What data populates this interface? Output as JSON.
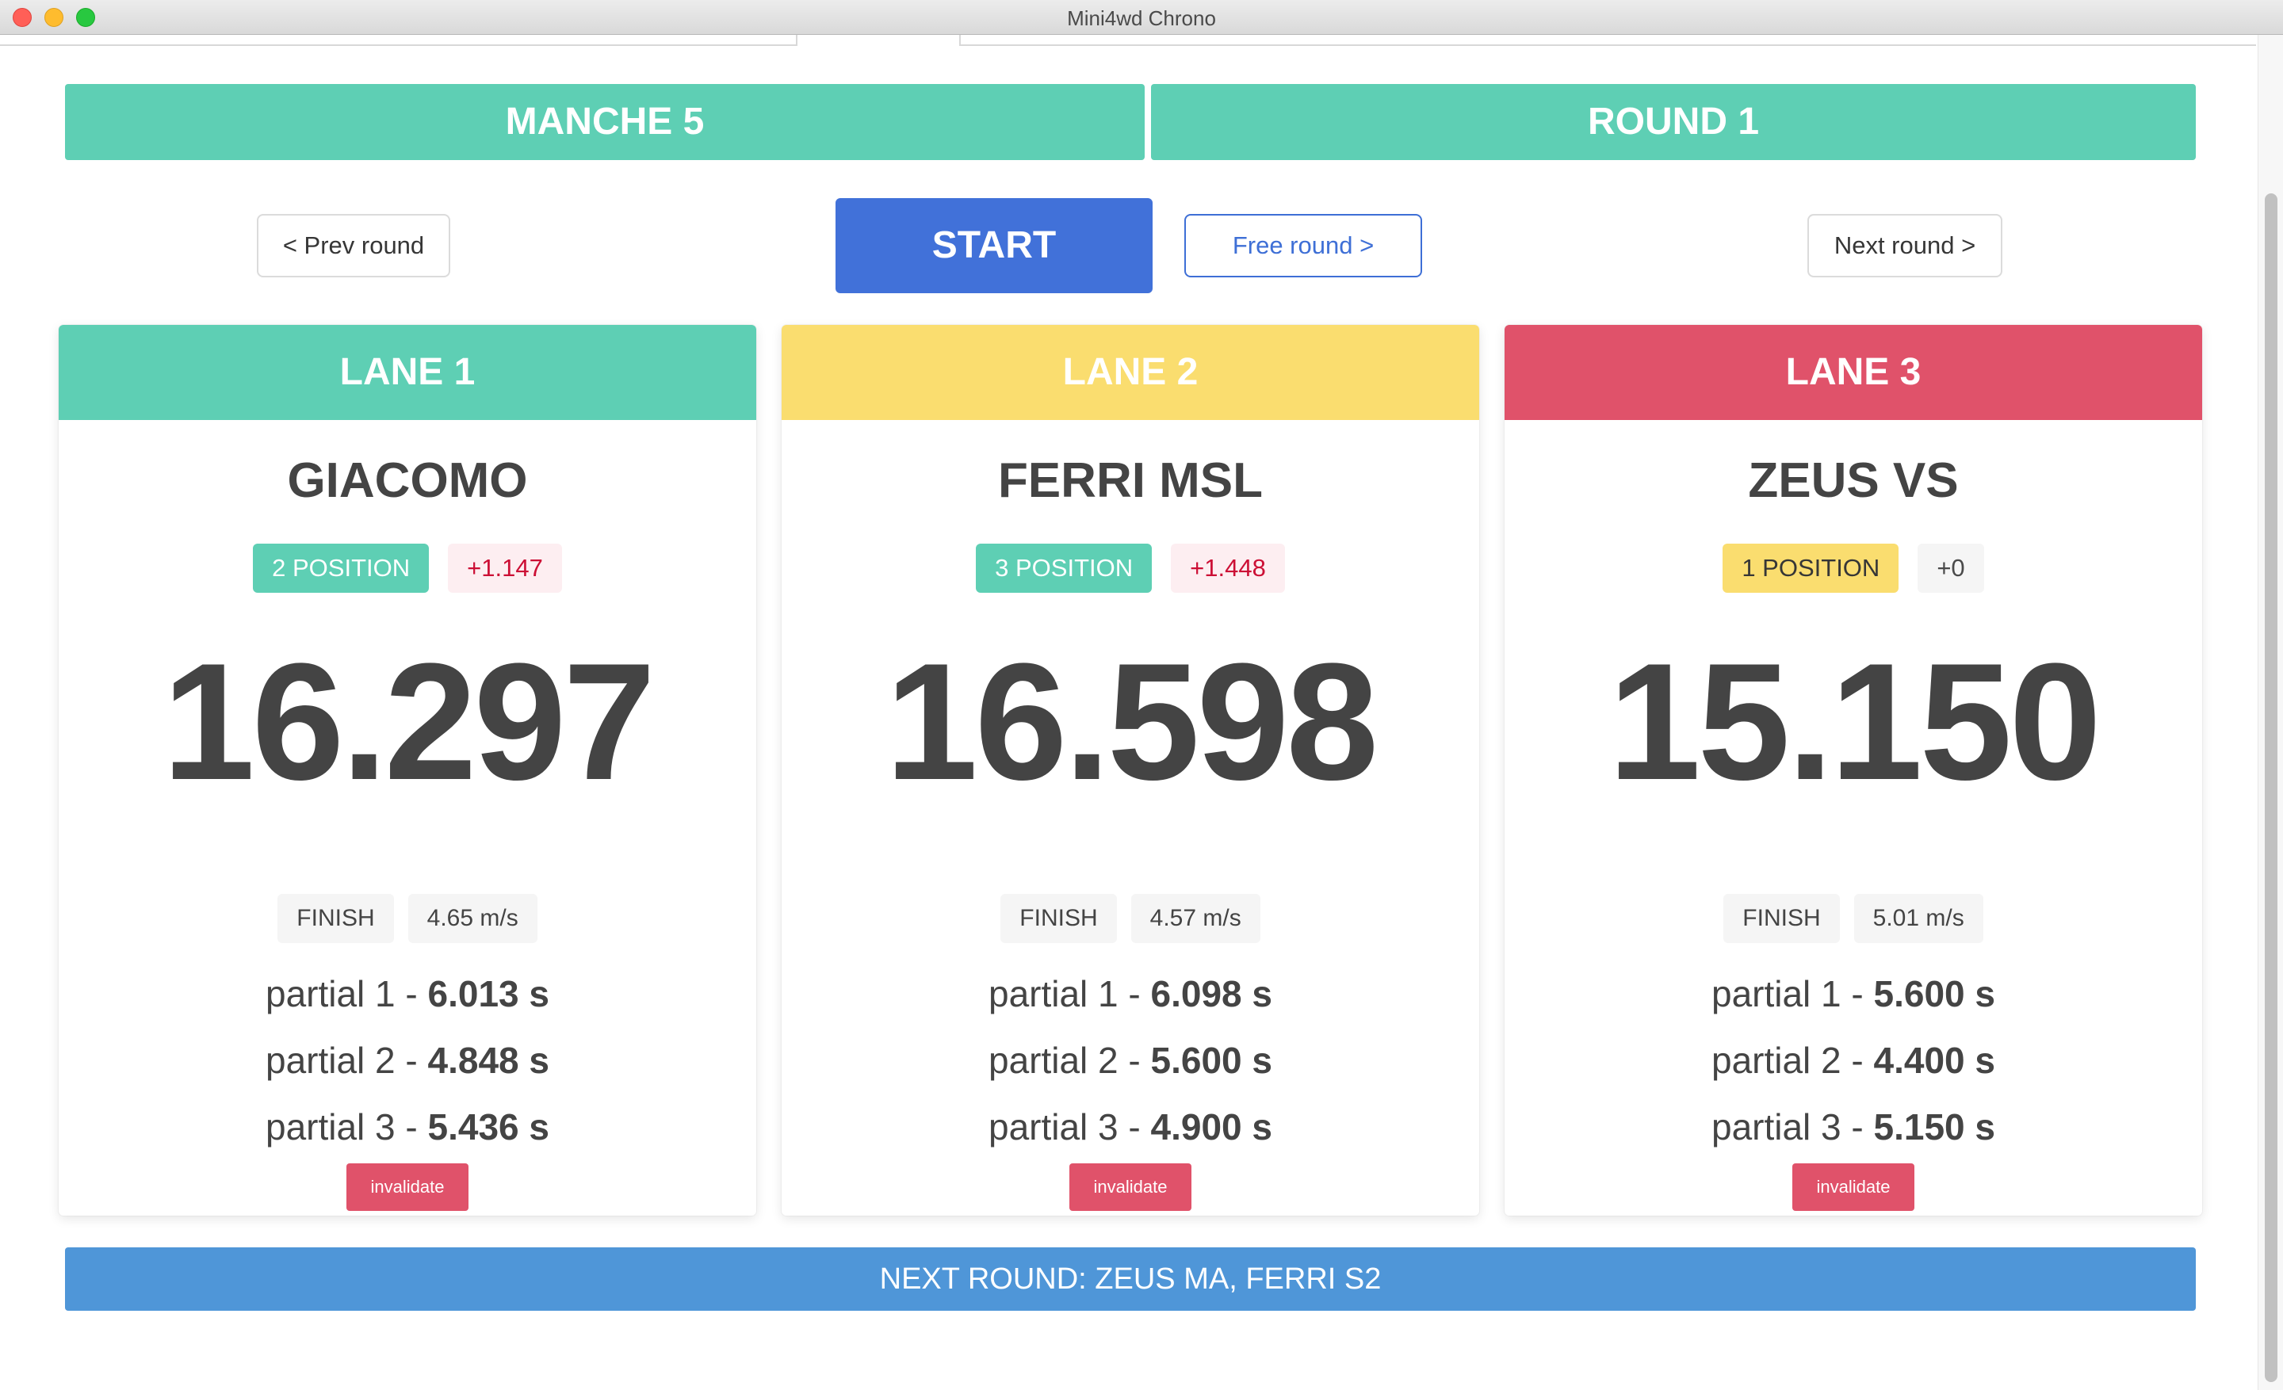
{
  "window": {
    "title": "Mini4wd Chrono"
  },
  "header": {
    "manche": "MANCHE 5",
    "round": "ROUND 1"
  },
  "controls": {
    "prev_label": "< Prev round",
    "start_label": "START",
    "free_label": "Free round >",
    "next_label": "Next round >"
  },
  "lanes": [
    {
      "label": "LANE 1",
      "color": "#5ecfb4",
      "driver": "GIACOMO",
      "position": "2 POSITION",
      "gap": "+1.147",
      "time": "16.297",
      "status": "FINISH",
      "speed": "4.65 m/s",
      "partials": [
        {
          "label": "partial 1 - ",
          "value": "6.013 s"
        },
        {
          "label": "partial 2 - ",
          "value": "4.848 s"
        },
        {
          "label": "partial 3 - ",
          "value": "5.436 s"
        }
      ],
      "invalidate_label": "invalidate"
    },
    {
      "label": "LANE 2",
      "color": "#fadd6f",
      "driver": "FERRI MSL",
      "position": "3 POSITION",
      "gap": "+1.448",
      "time": "16.598",
      "status": "FINISH",
      "speed": "4.57 m/s",
      "partials": [
        {
          "label": "partial 1 - ",
          "value": "6.098 s"
        },
        {
          "label": "partial 2 - ",
          "value": "5.600 s"
        },
        {
          "label": "partial 3 - ",
          "value": "4.900 s"
        }
      ],
      "invalidate_label": "invalidate"
    },
    {
      "label": "LANE 3",
      "color": "#e0526a",
      "driver": "ZEUS VS",
      "position": "1 POSITION",
      "gap": "+0",
      "time": "15.150",
      "status": "FINISH",
      "speed": "5.01 m/s",
      "partials": [
        {
          "label": "partial 1 - ",
          "value": "5.600 s"
        },
        {
          "label": "partial 2 - ",
          "value": "4.400 s"
        },
        {
          "label": "partial 3 - ",
          "value": "5.150 s"
        }
      ],
      "invalidate_label": "invalidate"
    }
  ],
  "next_round": "NEXT ROUND: ZEUS MA, FERRI S2",
  "colors": {
    "accent_green": "#5ecfb4",
    "accent_yellow": "#fadd6f",
    "accent_red": "#e0526a",
    "start_blue": "#4171d9",
    "banner_blue": "#4f96d8"
  }
}
